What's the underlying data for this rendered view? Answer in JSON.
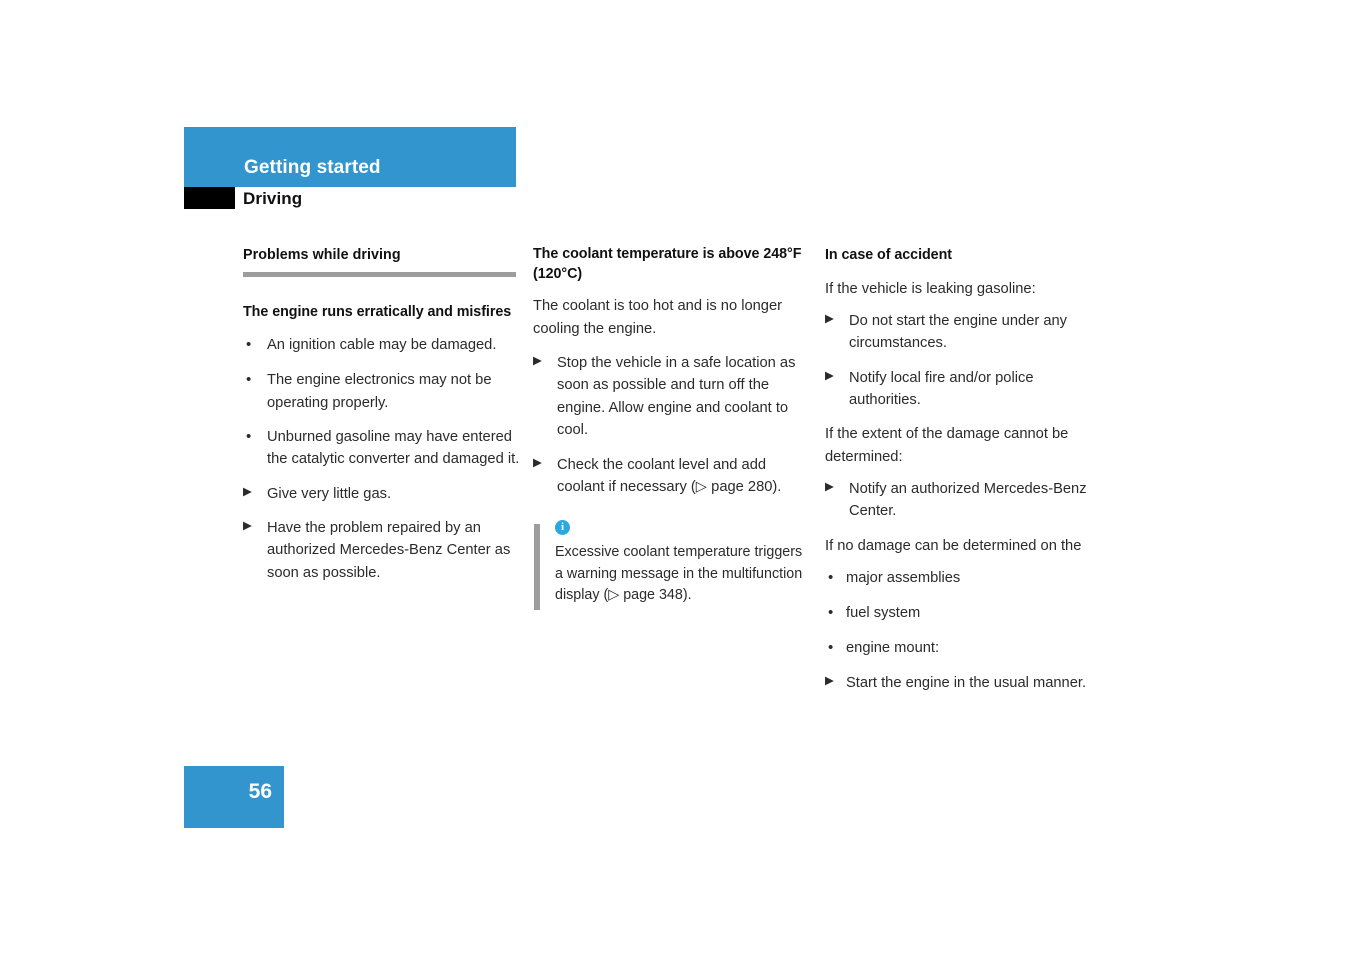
{
  "header": {
    "banner_title": "Getting started",
    "subtitle": "Driving",
    "banner_color": "#3295ce",
    "tab_color": "#000000"
  },
  "column_1": {
    "section_title": "Problems while driving",
    "sub_title": "The engine runs erratically and misfires",
    "items": [
      {
        "marker": "•",
        "text": "An ignition cable may be damaged."
      },
      {
        "marker": "•",
        "text": "The engine electronics may not be operating properly."
      },
      {
        "marker": "•",
        "text": "Unburned gasoline may have entered the catalytic converter and damaged it."
      },
      {
        "marker": "▶",
        "text": "Give very little gas."
      },
      {
        "marker": "▶",
        "text": "Have the problem repaired by an authorized Mercedes-Benz Center as soon as possible."
      }
    ]
  },
  "column_2": {
    "sub_title": "The coolant temperature is above 248°F (120°C)",
    "intro": "The coolant is too hot and is no longer cooling the engine.",
    "items": [
      {
        "marker": "▶",
        "text": "Stop the vehicle in a safe location as soon as possible and turn off the engine. Allow engine and coolant to cool."
      },
      {
        "marker": "▶",
        "text": "Check the coolant level and add coolant if necessary (▷ page 280)."
      }
    ],
    "note": {
      "icon": "info-icon",
      "icon_glyph": "i",
      "icon_color": "#2aa8e0",
      "text": "Excessive coolant temperature triggers a warning message in the multifunction display (▷ page 348)."
    }
  },
  "column_3": {
    "sub_title": "In case of accident",
    "intro_1": "If the vehicle is leaking gasoline:",
    "items_1": [
      {
        "marker": "▶",
        "text": "Do not start the engine under any circumstances."
      },
      {
        "marker": "▶",
        "text": "Notify local fire and/or police authorities."
      }
    ],
    "intro_2": "If the extent of the damage cannot be determined:",
    "items_2": [
      {
        "marker": "▶",
        "text": "Notify an authorized Mercedes-Benz Center."
      }
    ],
    "intro_3": "If no damage can be determined on the",
    "items_3": [
      {
        "marker": "•",
        "text": "major assemblies"
      },
      {
        "marker": "•",
        "text": "fuel system"
      },
      {
        "marker": "•",
        "text": "engine mount:"
      },
      {
        "marker": "▶",
        "text": "Start the engine in the usual manner."
      }
    ]
  },
  "footer": {
    "page_number": "56"
  }
}
